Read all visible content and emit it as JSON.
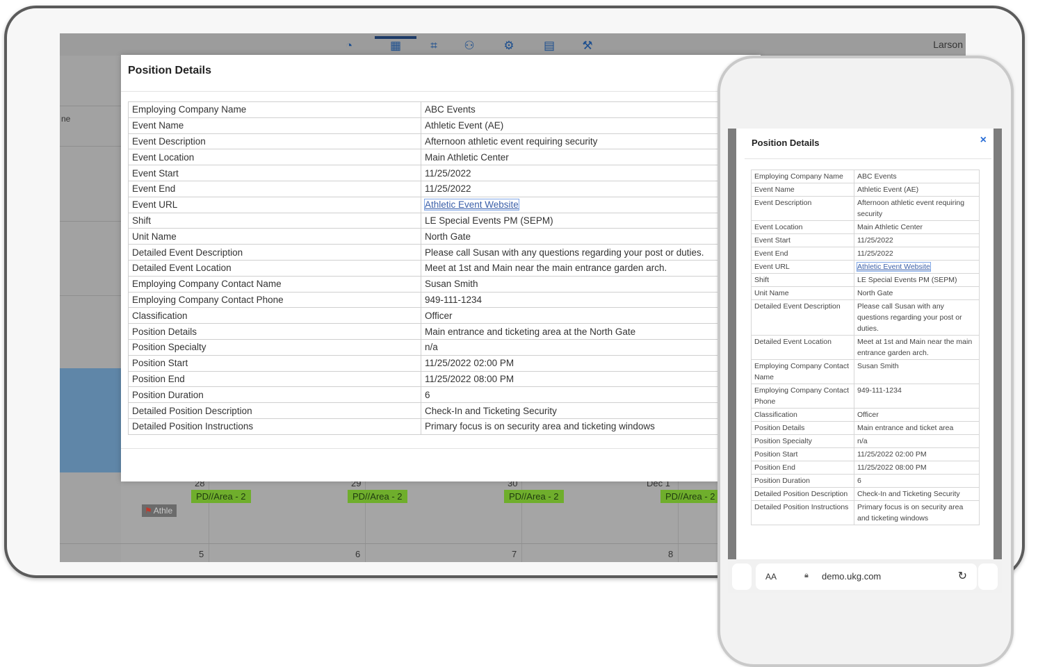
{
  "header": {
    "user_name": "Larson"
  },
  "left_column": {
    "label": "ne"
  },
  "calendar": {
    "day_labels": [
      "28",
      "29",
      "30",
      "Dec 1"
    ],
    "week_numbers": [
      "5",
      "6",
      "7",
      "8"
    ],
    "event_chips": [
      "PD//Area - 2",
      "PD//Area - 2",
      "PD//Area - 2",
      "PD//Area - 2"
    ],
    "athle_label": "Athle"
  },
  "modal": {
    "title": "Position Details",
    "rows": [
      {
        "key": "Employing Company Name",
        "value": "ABC Events"
      },
      {
        "key": "Event Name",
        "value": "Athletic Event (AE)"
      },
      {
        "key": "Event Description",
        "value": "Afternoon athletic event requiring security"
      },
      {
        "key": "Event Location",
        "value": "Main Athletic Center"
      },
      {
        "key": "Event Start",
        "value": "11/25/2022"
      },
      {
        "key": "Event End",
        "value": "11/25/2022"
      },
      {
        "key": "Event URL",
        "value": "Athletic Event Website"
      },
      {
        "key": "Shift",
        "value": "LE Special Events PM (SEPM)"
      },
      {
        "key": "Unit Name",
        "value": "North Gate"
      },
      {
        "key": "Detailed Event Description",
        "value": "Please call Susan with any questions regarding your post or duties."
      },
      {
        "key": "Detailed Event Location",
        "value": "Meet at 1st and Main near the main entrance garden arch."
      },
      {
        "key": "Employing Company Contact Name",
        "value": "Susan Smith"
      },
      {
        "key": "Employing Company Contact Phone",
        "value": "949-111-1234"
      },
      {
        "key": "Classification",
        "value": "Officer"
      },
      {
        "key": "Position Details",
        "value": " Main entrance and ticketing area at the North Gate"
      },
      {
        "key": "Position Specialty",
        "value": " n/a"
      },
      {
        "key": "Position Start",
        "value": "11/25/2022 02:00 PM"
      },
      {
        "key": "Position End",
        "value": "11/25/2022 08:00 PM"
      },
      {
        "key": "Position Duration",
        "value": "6"
      },
      {
        "key": "Detailed Position Description",
        "value": " Check-In and Ticketing Security"
      },
      {
        "key": "Detailed Position Instructions",
        "value": " Primary focus is on security area and ticketing windows"
      }
    ]
  },
  "phone": {
    "title": "Position Details",
    "close_icon": "×",
    "rows": [
      {
        "key": "Employing Company Name",
        "value": "ABC Events"
      },
      {
        "key": "Event Name",
        "value": "Athletic Event (AE)"
      },
      {
        "key": "Event Description",
        "value": "Afternoon athletic event requiring security"
      },
      {
        "key": "Event Location",
        "value": "Main Athletic Center"
      },
      {
        "key": "Event Start",
        "value": "11/25/2022"
      },
      {
        "key": "Event End",
        "value": "11/25/2022"
      },
      {
        "key": "Event URL",
        "value": "Athletic Event Website"
      },
      {
        "key": "Shift",
        "value": "LE Special Events PM (SEPM)"
      },
      {
        "key": "Unit Name",
        "value": "North Gate"
      },
      {
        "key": "Detailed Event Description",
        "value": "Please call Susan with any questions regarding your post or duties."
      },
      {
        "key": "Detailed Event Location",
        "value": "Meet at 1st and Main near the main entrance garden arch."
      },
      {
        "key": "Employing Company Contact Name",
        "value": "Susan Smith"
      },
      {
        "key": "Employing Company Contact Phone",
        "value": "949-111-1234"
      },
      {
        "key": "Classification",
        "value": "Officer"
      },
      {
        "key": "Position Details",
        "value": "Main entrance and ticket area"
      },
      {
        "key": "Position Specialty",
        "value": "n/a"
      },
      {
        "key": "Position Start",
        "value": "11/25/2022 02:00 PM"
      },
      {
        "key": "Position End",
        "value": "11/25/2022 08:00 PM"
      },
      {
        "key": "Position Duration",
        "value": "6"
      },
      {
        "key": "Detailed Position Description",
        "value": "Check-In and Ticketing Security"
      },
      {
        "key": "Detailed Position Instructions",
        "value": "Primary focus is on security area and ticketing windows"
      }
    ],
    "address_bar": {
      "text_size_label": "AA",
      "host": "demo.ukg.com"
    }
  }
}
